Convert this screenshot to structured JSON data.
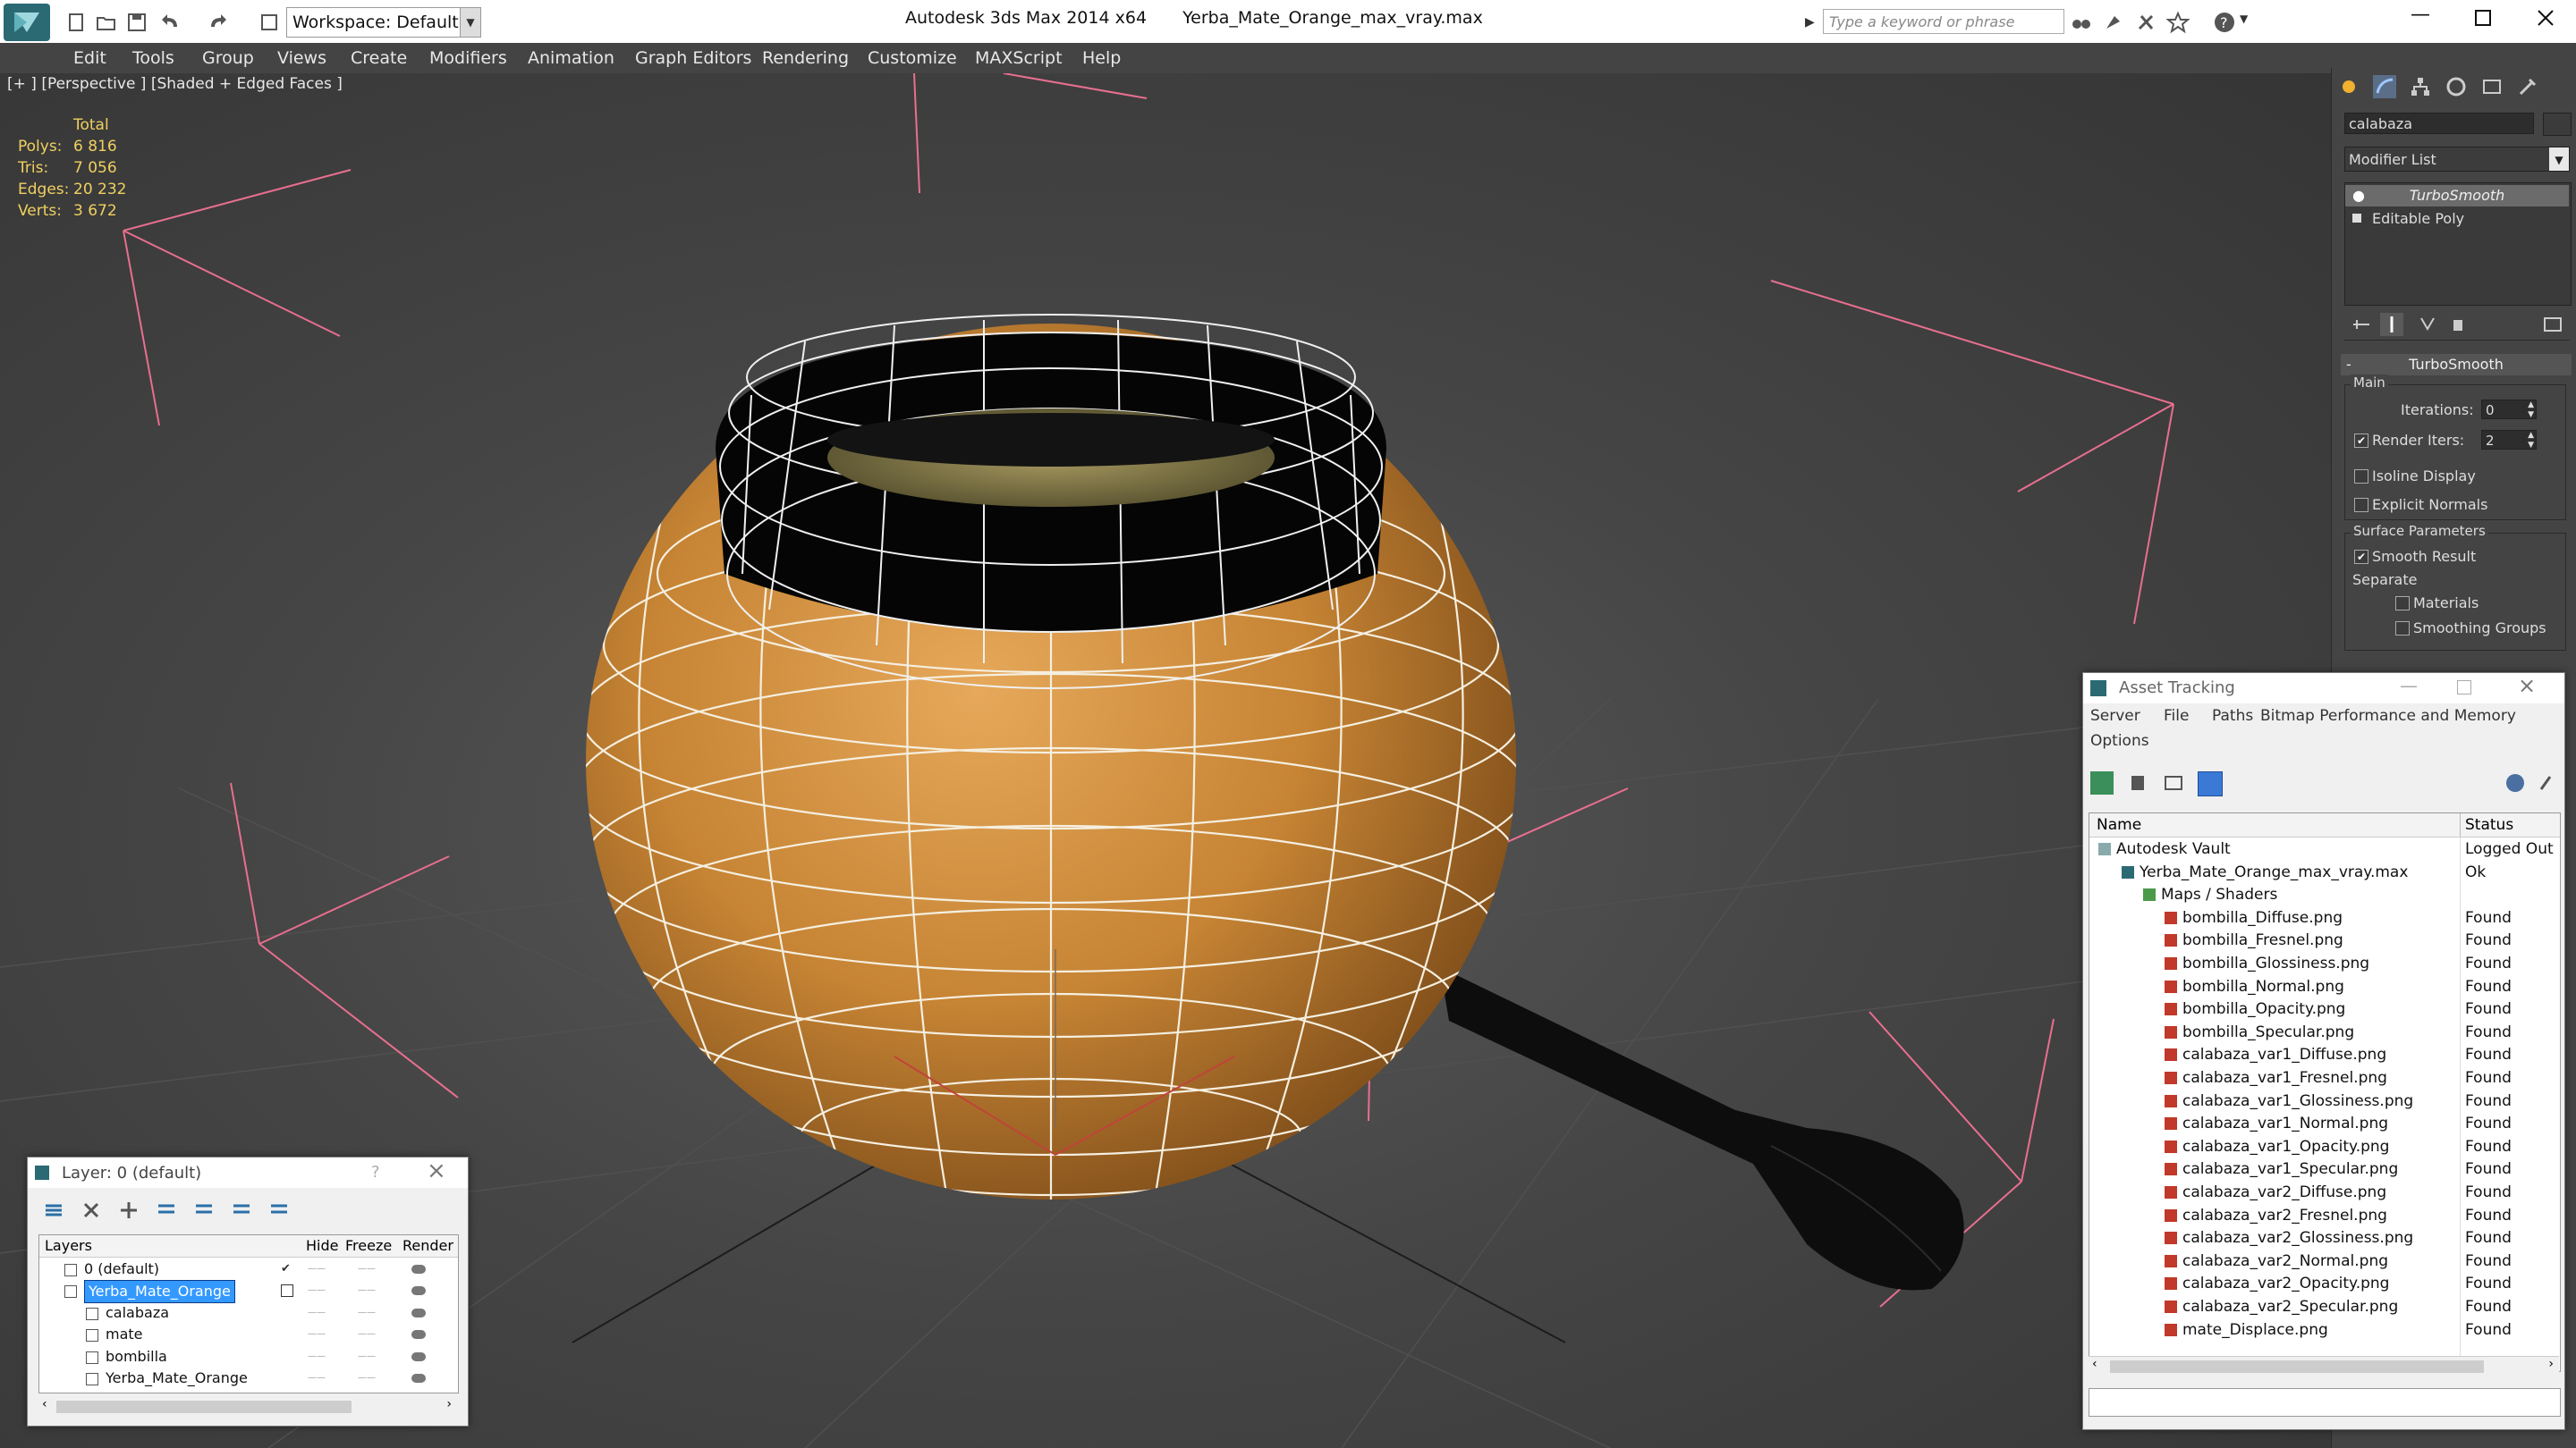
{
  "window": {
    "title": "Autodesk 3ds Max 2014 x64",
    "filename": "Yerba_Mate_Orange_max_vray.max",
    "workspace": "Workspace: Default",
    "search_placeholder": "Type a keyword or phrase"
  },
  "menu": [
    "Edit",
    "Tools",
    "Group",
    "Views",
    "Create",
    "Modifiers",
    "Animation",
    "Graph Editors",
    "Rendering",
    "Customize",
    "MAXScript",
    "Help"
  ],
  "viewport": {
    "label": "[+ ] [Perspective ] [Shaded + Edged Faces ]",
    "stats": {
      "header": "Total",
      "rows": [
        {
          "label": "Polys:",
          "value": "6 816"
        },
        {
          "label": "Tris:",
          "value": "7 056"
        },
        {
          "label": "Edges:",
          "value": "20 232"
        },
        {
          "label": "Verts:",
          "value": "3 672"
        }
      ]
    }
  },
  "command_panel": {
    "object_name": "calabaza",
    "modifier_list": "Modifier List",
    "stack": [
      "TurboSmooth",
      "Editable Poly"
    ],
    "rollout_title": "TurboSmooth",
    "main_group": "Main",
    "iterations_label": "Iterations:",
    "iterations_value": "0",
    "render_iters_label": "Render Iters:",
    "render_iters_value": "2",
    "isoline": "Isoline Display",
    "explicit_normals": "Explicit Normals",
    "surface_group": "Surface Parameters",
    "smooth_result": "Smooth Result",
    "separate": "Separate",
    "materials": "Materials",
    "smoothing_groups": "Smoothing Groups"
  },
  "asset_tracking": {
    "title": "Asset Tracking",
    "menu": [
      "Server",
      "File",
      "Paths",
      "Bitmap Performance and Memory",
      "Options"
    ],
    "columns": [
      "Name",
      "Status"
    ],
    "rows": [
      {
        "name": "Autodesk Vault",
        "status": "Logged Out",
        "level": 0
      },
      {
        "name": "Yerba_Mate_Orange_max_vray.max",
        "status": "Ok",
        "level": 1
      },
      {
        "name": "Maps / Shaders",
        "status": "",
        "level": 2
      },
      {
        "name": "bombilla_Diffuse.png",
        "status": "Found",
        "level": 3
      },
      {
        "name": "bombilla_Fresnel.png",
        "status": "Found",
        "level": 3
      },
      {
        "name": "bombilla_Glossiness.png",
        "status": "Found",
        "level": 3
      },
      {
        "name": "bombilla_Normal.png",
        "status": "Found",
        "level": 3
      },
      {
        "name": "bombilla_Opacity.png",
        "status": "Found",
        "level": 3
      },
      {
        "name": "bombilla_Specular.png",
        "status": "Found",
        "level": 3
      },
      {
        "name": "calabaza_var1_Diffuse.png",
        "status": "Found",
        "level": 3
      },
      {
        "name": "calabaza_var1_Fresnel.png",
        "status": "Found",
        "level": 3
      },
      {
        "name": "calabaza_var1_Glossiness.png",
        "status": "Found",
        "level": 3
      },
      {
        "name": "calabaza_var1_Normal.png",
        "status": "Found",
        "level": 3
      },
      {
        "name": "calabaza_var1_Opacity.png",
        "status": "Found",
        "level": 3
      },
      {
        "name": "calabaza_var1_Specular.png",
        "status": "Found",
        "level": 3
      },
      {
        "name": "calabaza_var2_Diffuse.png",
        "status": "Found",
        "level": 3
      },
      {
        "name": "calabaza_var2_Fresnel.png",
        "status": "Found",
        "level": 3
      },
      {
        "name": "calabaza_var2_Glossiness.png",
        "status": "Found",
        "level": 3
      },
      {
        "name": "calabaza_var2_Normal.png",
        "status": "Found",
        "level": 3
      },
      {
        "name": "calabaza_var2_Opacity.png",
        "status": "Found",
        "level": 3
      },
      {
        "name": "calabaza_var2_Specular.png",
        "status": "Found",
        "level": 3
      },
      {
        "name": "mate_Displace.png",
        "status": "Found",
        "level": 3
      }
    ]
  },
  "layer_window": {
    "title": "Layer: 0 (default)",
    "help": "?",
    "columns": [
      "Layers",
      "Hide",
      "Freeze",
      "Render"
    ],
    "rows": [
      {
        "name": "0 (default)",
        "level": 0,
        "selected": false,
        "current": true
      },
      {
        "name": "Yerba_Mate_Orange",
        "level": 0,
        "selected": true,
        "current": false
      },
      {
        "name": "calabaza",
        "level": 1,
        "selected": false,
        "current": false
      },
      {
        "name": "mate",
        "level": 1,
        "selected": false,
        "current": false
      },
      {
        "name": "bombilla",
        "level": 1,
        "selected": false,
        "current": false
      },
      {
        "name": "Yerba_Mate_Orange",
        "level": 1,
        "selected": false,
        "current": false
      }
    ]
  },
  "colors": {
    "accent_selection": "#3399ff",
    "stats_yellow": "#f0d060",
    "grid_pink": "#ff7fa0",
    "gourd": "#c98a3c"
  }
}
